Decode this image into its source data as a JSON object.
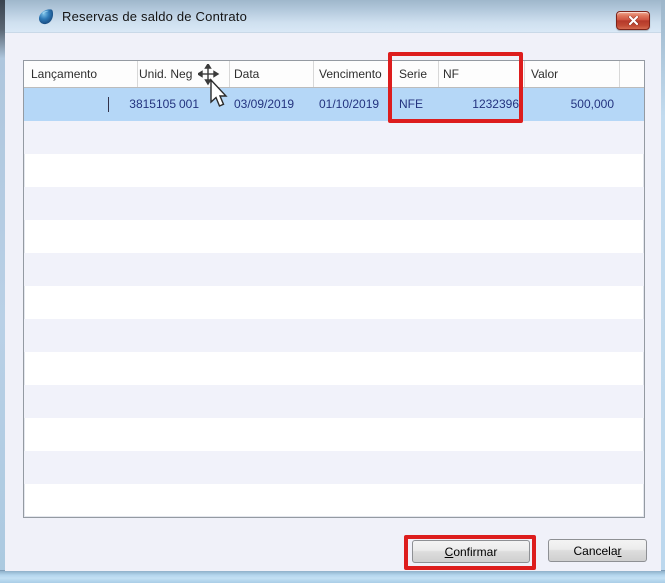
{
  "window": {
    "title": "Reservas de saldo de Contrato"
  },
  "table": {
    "headers": {
      "lancamento": "Lançamento",
      "unid_neg": "Unid. Neg",
      "data": "Data",
      "vencimento": "Vencimento",
      "serie": "Serie",
      "nf": "NF",
      "valor": "Valor"
    },
    "row": {
      "lancamento": "3815105",
      "unid_neg": "001",
      "data": "03/09/2019",
      "vencimento": "01/10/2019",
      "serie": "NFE",
      "nf": "1232396",
      "valor": "500,000"
    }
  },
  "buttons": {
    "confirm": {
      "accel": "C",
      "rest": "onfirmar"
    },
    "cancel": {
      "pre": "Cancela",
      "accel": "r"
    }
  },
  "annotations": {
    "highlight_color": "#dd1d1d"
  },
  "colors": {
    "selected_row_bg": "#b5d7f7",
    "row_text_color": "#23337f"
  }
}
